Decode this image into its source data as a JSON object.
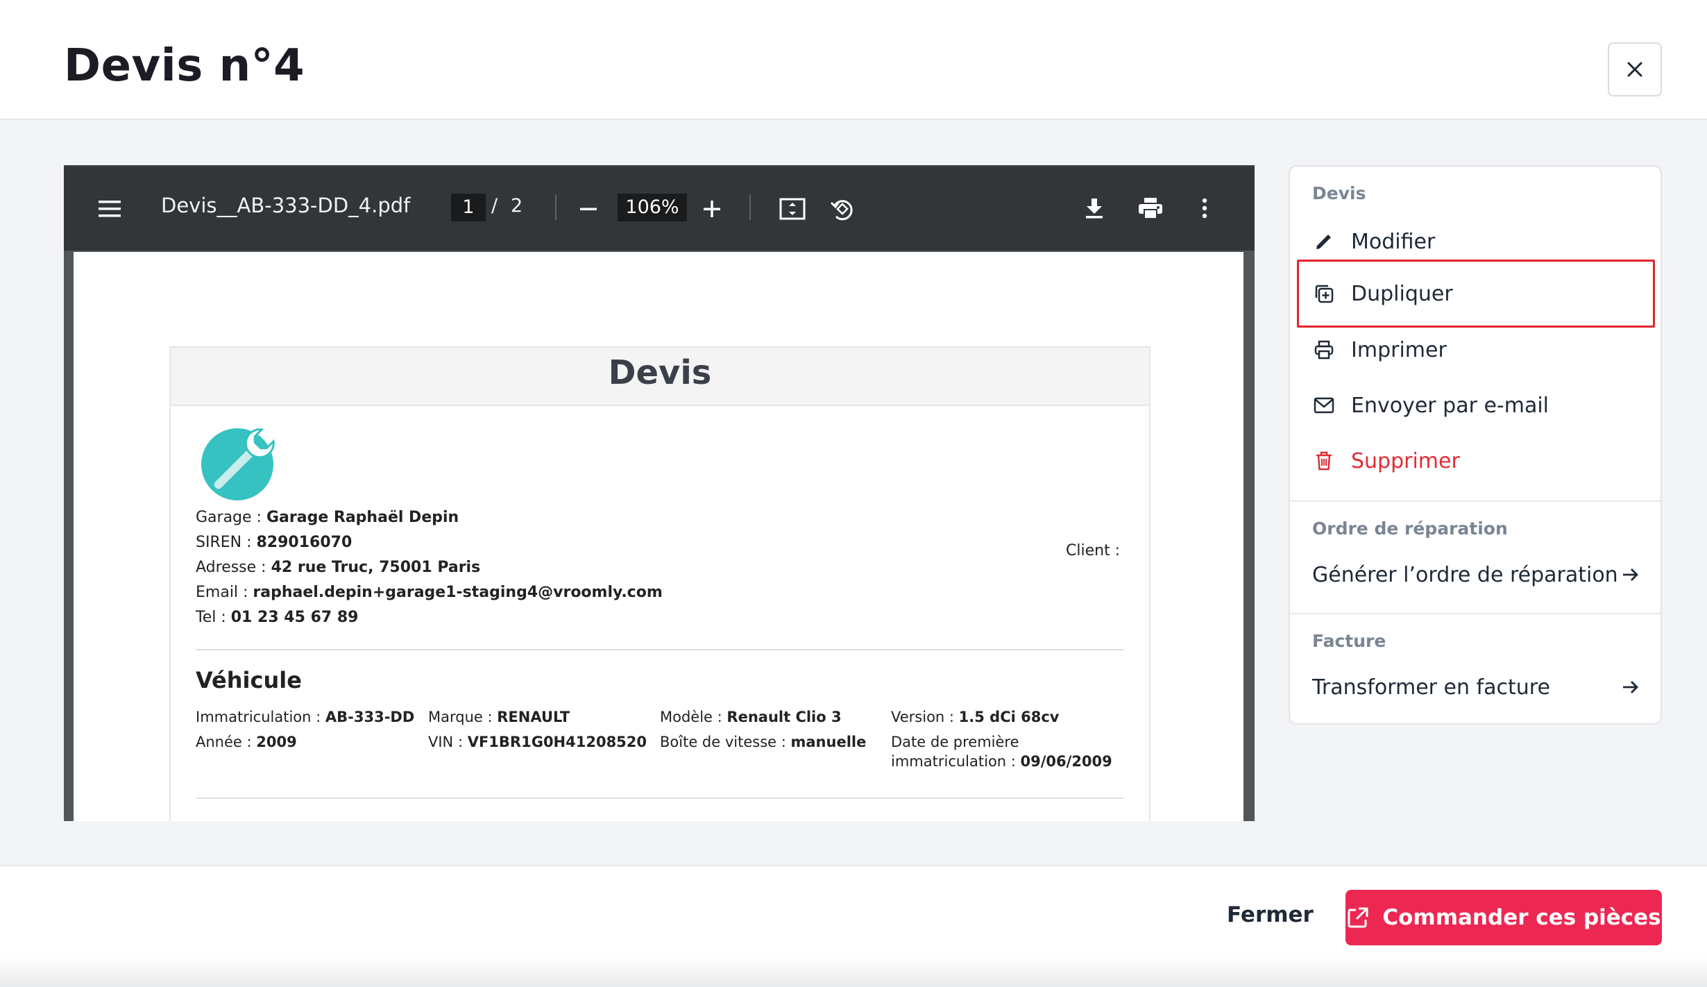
{
  "modal": {
    "title": "Devis n°4"
  },
  "pdf_viewer": {
    "filename": "Devis__AB-333-DD_4.pdf",
    "page_current": "1",
    "page_separator": "/",
    "page_total": "2",
    "zoom": "106%"
  },
  "document": {
    "title": "Devis",
    "garage": {
      "label": "Garage : ",
      "value": "Garage Raphaël Depin"
    },
    "siren": {
      "label": "SIREN : ",
      "value": "829016070"
    },
    "address": {
      "label": "Adresse : ",
      "value": "42 rue Truc, 75001 Paris"
    },
    "email": {
      "label": "Email : ",
      "value": "raphael.depin+garage1-staging4@vroomly.com"
    },
    "tel": {
      "label": "Tel : ",
      "value": "01 23 45 67 89"
    },
    "client_label": "Client :",
    "vehicle_section_title": "Véhicule",
    "vehicle": {
      "immatriculation": {
        "label": "Immatriculation : ",
        "value": "AB-333-DD"
      },
      "annee": {
        "label": "Année : ",
        "value": "2009"
      },
      "marque": {
        "label": "Marque : ",
        "value": "RENAULT"
      },
      "vin": {
        "label": "VIN : ",
        "value": "VF1BR1G0H41208520"
      },
      "modele": {
        "label": "Modèle : ",
        "value": "Renault Clio 3"
      },
      "boite": {
        "label": "Boîte de vitesse : ",
        "value": "manuelle"
      },
      "version": {
        "label": "Version : ",
        "value": "1.5 dCi 68cv"
      },
      "date_immat": {
        "label_line1": "Date de première",
        "label_line2": "immatriculation : ",
        "value": "09/06/2009"
      }
    }
  },
  "actions": {
    "devis_section": "Devis",
    "modifier": "Modifier",
    "dupliquer": "Dupliquer",
    "imprimer": "Imprimer",
    "envoyer": "Envoyer par e-mail",
    "supprimer": "Supprimer",
    "ordre_section": "Ordre de réparation",
    "generer_ordre": "Générer l’ordre de réparation",
    "facture_section": "Facture",
    "transformer_facture": "Transformer en facture"
  },
  "footer": {
    "close_label": "Fermer",
    "order_label": "Commander ces pièces"
  },
  "colors": {
    "primary": "#ec2852",
    "danger": "#e12c33",
    "highlight_border": "#e5252a",
    "logo_teal": "#36c2c0",
    "viewer_toolbar": "#323639"
  },
  "icons": {
    "close": "close-icon",
    "menu": "menu-icon",
    "zoom_out": "minus-icon",
    "zoom_in": "plus-icon",
    "fit": "fit-page-icon",
    "rotate": "rotate-icon",
    "download": "download-icon",
    "print": "print-icon",
    "more": "more-vertical-icon",
    "modifier": "pencil-icon",
    "dupliquer": "duplicate-icon",
    "imprimer": "printer-icon",
    "envoyer": "mail-icon",
    "supprimer": "trash-icon",
    "arrow": "arrow-right-icon",
    "order": "external-link-icon",
    "logo": "wrench-icon"
  }
}
